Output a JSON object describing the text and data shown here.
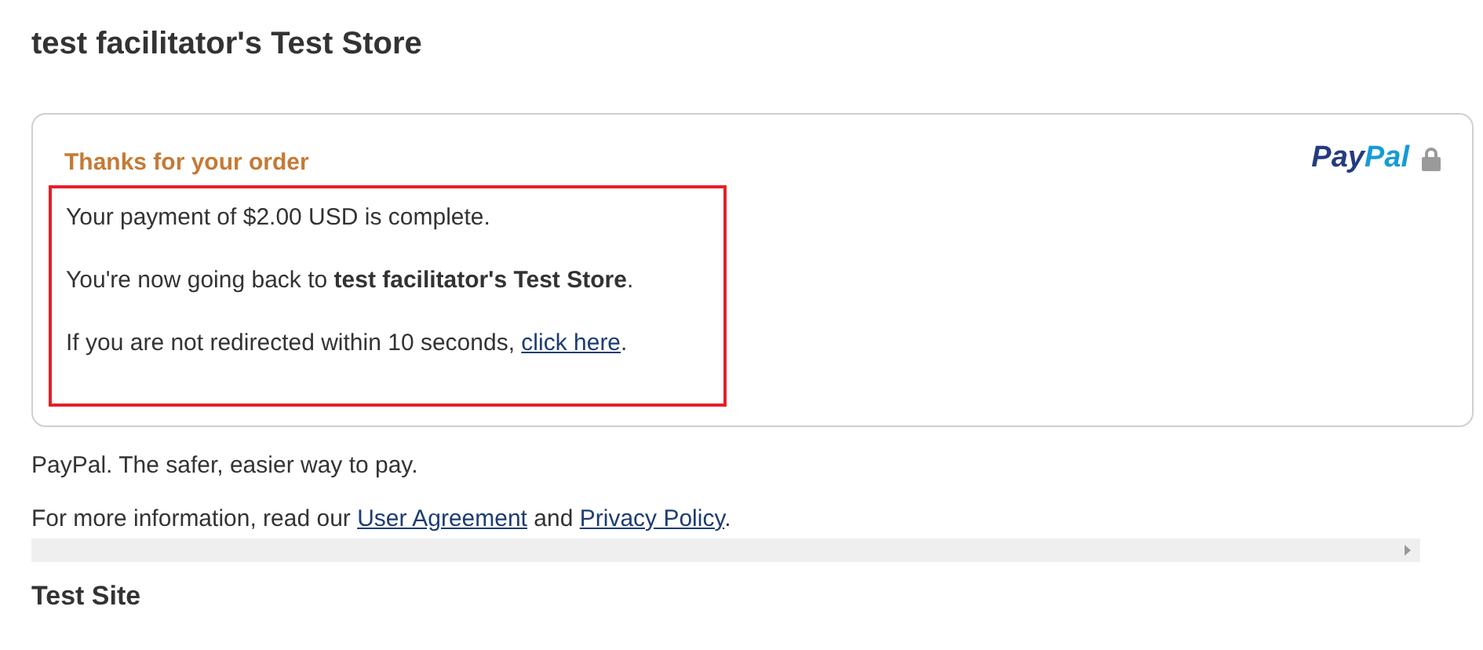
{
  "page_title": "test facilitator's Test Store",
  "card": {
    "heading": "Thanks for your order",
    "logo_parts": [
      "Pay",
      "Pal"
    ],
    "highlighted": true,
    "lines": [
      [
        {
          "kind": "text",
          "text": "Your payment of $2.00 USD is complete."
        }
      ],
      [
        {
          "kind": "text",
          "text": "You're now going back to **test facilitator's Test Store**."
        }
      ],
      [
        {
          "kind": "text",
          "text": "If you are not redirected within 10 seconds, "
        },
        {
          "kind": "link",
          "text": "click here"
        },
        {
          "kind": "text",
          "text": "."
        }
      ]
    ]
  },
  "footer": {
    "tagline": "PayPal. The safer, easier way to pay.",
    "info": [
      {
        "kind": "text",
        "text": "For more information, read our "
      },
      {
        "kind": "link",
        "text": "User Agreement"
      },
      {
        "kind": "text",
        "text": " and "
      },
      {
        "kind": "link",
        "text": "Privacy Policy"
      },
      {
        "kind": "text",
        "text": "."
      }
    ]
  },
  "site_name": "Test Site"
}
